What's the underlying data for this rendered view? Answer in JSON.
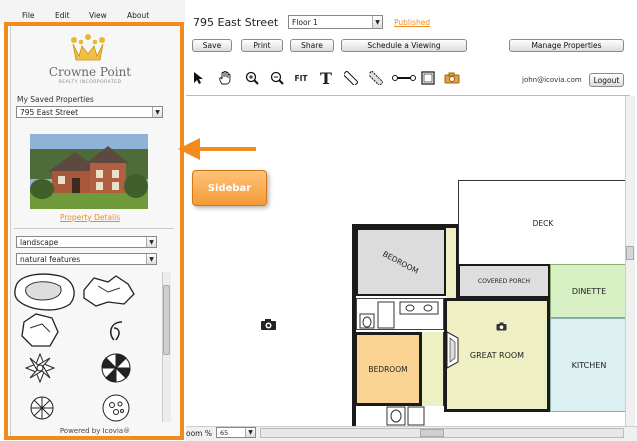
{
  "menu": {
    "file": "File",
    "edit": "Edit",
    "view": "View",
    "about": "About"
  },
  "header": {
    "address": "795 East Street",
    "floor": "Floor 1",
    "published": "Published",
    "user_email": "john@icovia.com",
    "logout": "Logout"
  },
  "toolbar": {
    "save": "Save",
    "print": "Print",
    "share": "Share",
    "schedule": "Schedule a Viewing",
    "manage": "Manage Properties",
    "fit": "FIT",
    "text_tool": "T"
  },
  "sidebar": {
    "brand_name": "Crowne Point",
    "brand_tagline": "REALTY INCORPORATED",
    "saved_label": "My Saved Properties",
    "saved_value": "795 East Street",
    "property_details": "Property Details",
    "category": "landscape",
    "subcategory": "natural features",
    "powered_by": "Powered by Icovia®"
  },
  "annotation": {
    "label": "Sidebar"
  },
  "floorplan": {
    "deck": "DECK",
    "bedroom1": "BEDROOM",
    "covered_porch": "COVERED PORCH",
    "dinette": "DINETTE",
    "great_room": "GREAT ROOM",
    "kitchen": "KITCHEN",
    "bedroom2": "BEDROOM"
  },
  "zoom": {
    "label": "oom %",
    "value": "65"
  },
  "colors": {
    "accent_orange": "#f28a1e",
    "bedroom_gray": "#dcdcdc",
    "porch_gray": "#dedede",
    "dinette_green": "#d6f0c4",
    "great_room_yellow": "#eef0c4",
    "kitchen_blue": "#dcf0f2",
    "bedroom_orange": "#fbd493"
  }
}
